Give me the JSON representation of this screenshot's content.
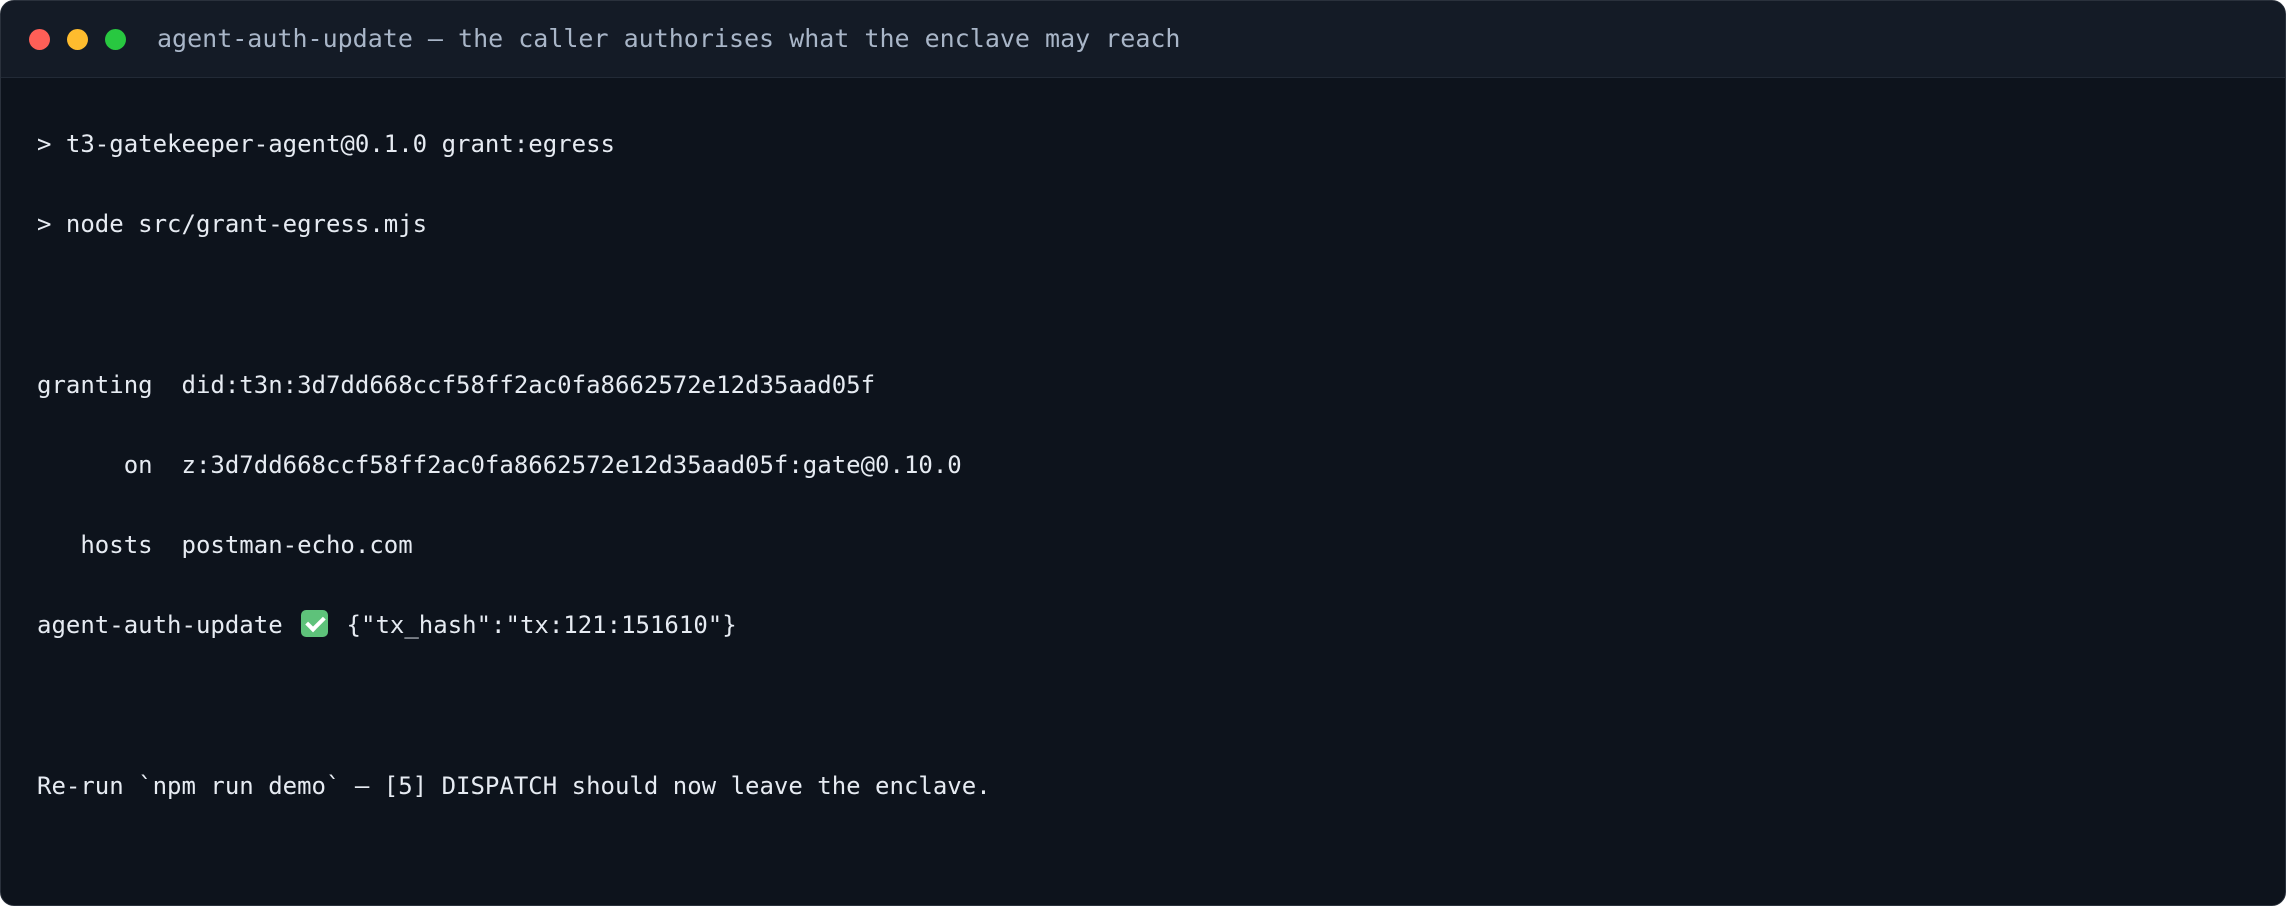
{
  "window": {
    "title": "agent-auth-update — the caller authorises what the enclave may reach"
  },
  "terminal": {
    "lines": [
      "> t3-gatekeeper-agent@0.1.0 grant:egress",
      "> node src/grant-egress.mjs",
      "granting  did:t3n:3d7dd668ccf58ff2ac0fa8662572e12d35aad05f",
      "      on  z:3d7dd668ccf58ff2ac0fa8662572e12d35aad05f:gate@0.10.0",
      "   hosts  postman-echo.com"
    ],
    "result": {
      "label": "agent-auth-update",
      "status_icon": "check-mark-icon",
      "payload": "{\"tx_hash\":\"tx:121:151610\"}"
    },
    "footer": "Re-run `npm run demo` — [5] DISPATCH should now leave the enclave."
  },
  "colors": {
    "background": "#0d131c",
    "titlebar": "#141b26",
    "text": "#e6ebf2",
    "title_text": "#a9b6c8",
    "close": "#ff5f57",
    "minimize": "#febc2e",
    "maximize": "#28c840",
    "check": "#5ec27a"
  }
}
